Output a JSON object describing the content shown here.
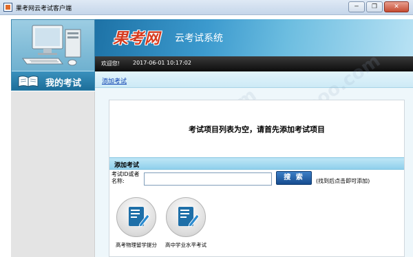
{
  "window": {
    "title": "果考网云考试客户端",
    "minimize": "─",
    "maximize": "❐",
    "close": "✕"
  },
  "brand": {
    "logo_text": "果考网",
    "subtitle": "云考试系统"
  },
  "welcome": {
    "greeting": "欢迎您!",
    "datetime": "2017-06-01 10:17:02"
  },
  "sidebar": {
    "header_label": "我的考试"
  },
  "toolbar": {
    "add_exam_link": "添加考试"
  },
  "main": {
    "empty_message": "考试项目列表为空，请首先添加考试项目",
    "add_section": {
      "title": "添加考试",
      "id_label": "考试ID或者名称:",
      "input_value": "",
      "search_button": "搜 索",
      "hint": "(找到后点击即可添加)"
    },
    "exam_items": [
      {
        "label": "高考物理留学提分"
      },
      {
        "label": "高中学业水平考试"
      }
    ]
  },
  "watermark": {
    "text": "www.ddooo.com"
  },
  "colors": {
    "banner": "#3c9ace",
    "brand_red": "#d63b1f",
    "link": "#0b3fb0",
    "section_head": "#8fd0ec",
    "search_button": "#164c8f"
  },
  "icons": {
    "app": "app-icon",
    "sidebar": "book-icon",
    "exam": "document-edit-icon",
    "header": "computer-icon"
  }
}
